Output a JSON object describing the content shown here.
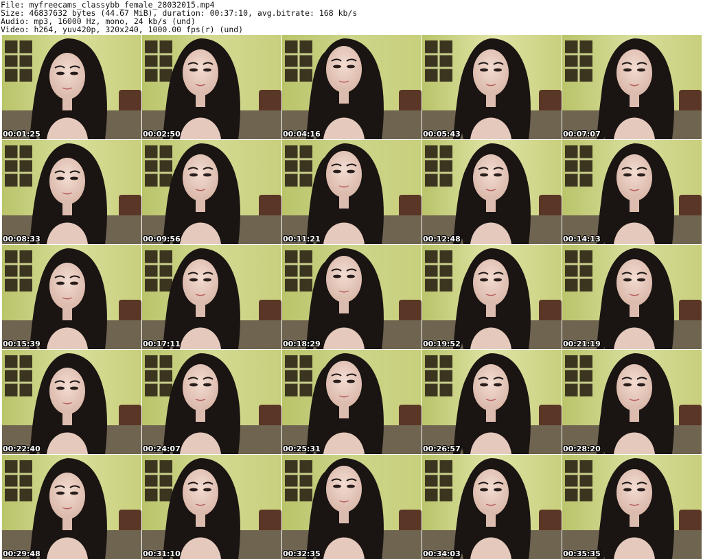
{
  "header": {
    "file_line": "File: myfreecams_classybb_female_28032015.mp4",
    "size_line": "Size: 46837632 bytes (44.67 MiB), duration: 00:37:10, avg.bitrate: 168 kb/s",
    "audio_line": "Audio: mp3, 16000 Hz, mono, 24 kb/s (und)",
    "video_line": "Video: h264, yuv420p, 320x240, 1000.00 fps(r) (und)"
  },
  "thumbnails": [
    {
      "time": "00:01:25"
    },
    {
      "time": "00:02:50"
    },
    {
      "time": "00:04:16"
    },
    {
      "time": "00:05:43"
    },
    {
      "time": "00:07:07"
    },
    {
      "time": "00:08:33"
    },
    {
      "time": "00:09:56"
    },
    {
      "time": "00:11:21"
    },
    {
      "time": "00:12:48"
    },
    {
      "time": "00:14:13"
    },
    {
      "time": "00:15:39"
    },
    {
      "time": "00:17:11"
    },
    {
      "time": "00:18:29"
    },
    {
      "time": "00:19:52"
    },
    {
      "time": "00:21:19"
    },
    {
      "time": "00:22:40"
    },
    {
      "time": "00:24:07"
    },
    {
      "time": "00:25:31"
    },
    {
      "time": "00:26:57"
    },
    {
      "time": "00:28:20"
    },
    {
      "time": "00:29:48"
    },
    {
      "time": "00:31:10"
    },
    {
      "time": "00:32:35"
    },
    {
      "time": "00:34:03"
    },
    {
      "time": "00:35:35"
    }
  ]
}
